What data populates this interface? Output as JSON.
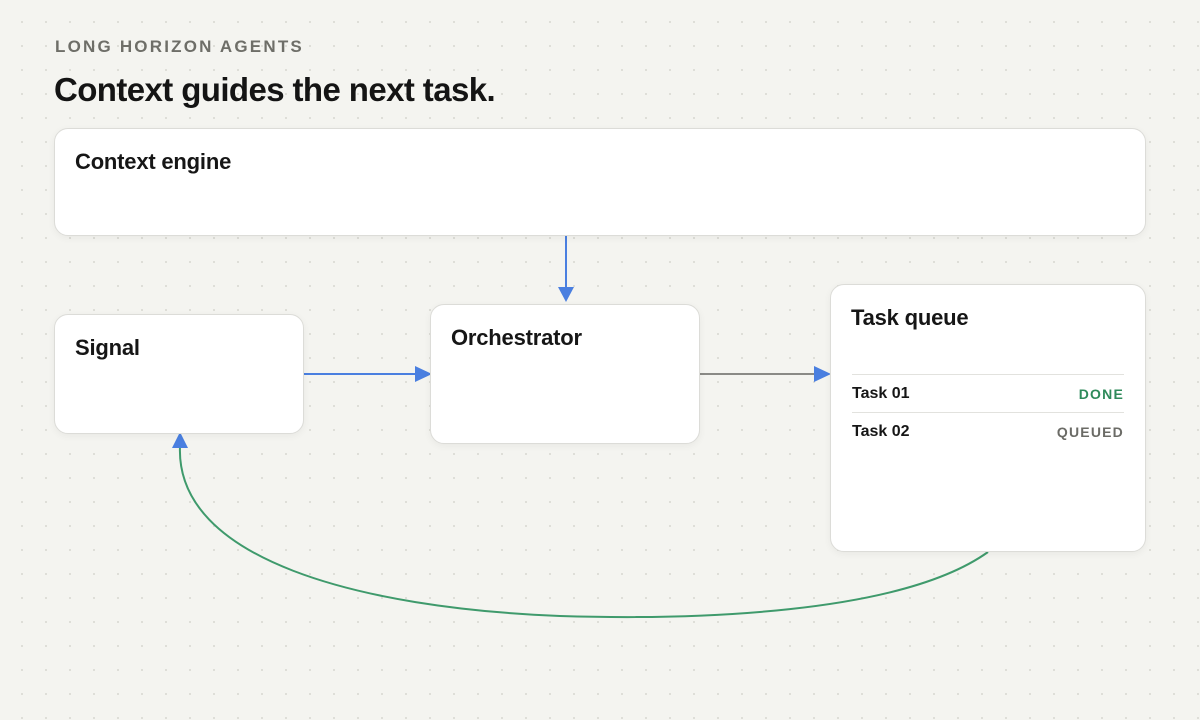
{
  "header": {
    "eyebrow": "LONG HORIZON AGENTS",
    "title": "Context guides the next task."
  },
  "nodes": {
    "context_engine": {
      "title": "Context engine"
    },
    "signal": {
      "title": "Signal"
    },
    "orchestrator": {
      "title": "Orchestrator"
    },
    "task_queue": {
      "title": "Task queue",
      "tasks": [
        {
          "name": "Task 01",
          "status": "DONE"
        },
        {
          "name": "Task 02",
          "status": "QUEUED"
        }
      ]
    }
  },
  "colors": {
    "background": "#f4f4f0",
    "card": "#ffffff",
    "arrow_blue": "#4a7fe0",
    "arrow_gray": "#8a8a86",
    "arrow_green": "#3f9a6c",
    "status_done": "#2e8a5a",
    "status_queued": "#6b6b66"
  }
}
